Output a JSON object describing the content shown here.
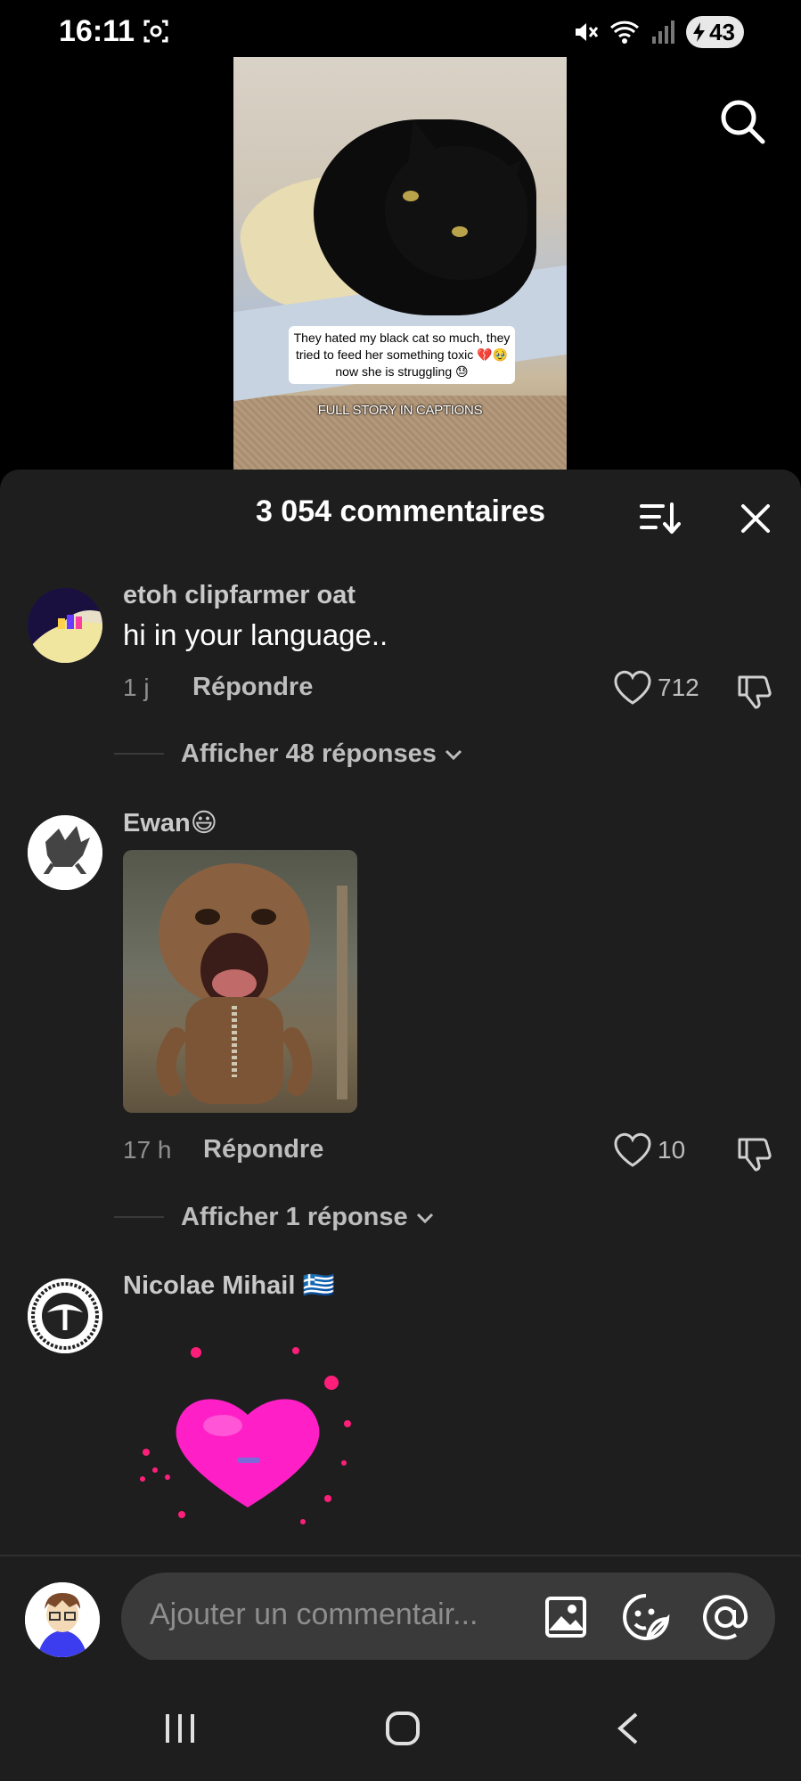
{
  "status_bar": {
    "time": "16:11",
    "battery": "43",
    "icons": [
      "screen-record-icon",
      "mute-icon",
      "wifi-icon",
      "signal-icon",
      "battery-charging-icon"
    ]
  },
  "video": {
    "caption": "They hated my black cat so much, they tried to feed her something toxic 💔🥹 now she is struggling 😓",
    "overlay_text": "FULL STORY IN CAPTIONS"
  },
  "comments_sheet": {
    "title": "3 054 commentaires",
    "comments": [
      {
        "username": "etoh clipfarmer oat",
        "text": "hi in your language..",
        "time": "1 j",
        "reply_label": "Répondre",
        "likes": "712",
        "replies_link": "Afficher 48 réponses"
      },
      {
        "username": "Ewan😃",
        "text": "",
        "time": "17 h",
        "reply_label": "Répondre",
        "likes": "10",
        "replies_link": "Afficher 1 réponse"
      },
      {
        "username": "Nicolae Mihail 🇬🇷",
        "text": ""
      }
    ]
  },
  "input_bar": {
    "placeholder": "Ajouter un commentair..."
  },
  "colors": {
    "sheet_bg": "#1e1e1e",
    "input_bg": "#3a3a3a",
    "heart_pink": "#ff1fc7"
  }
}
